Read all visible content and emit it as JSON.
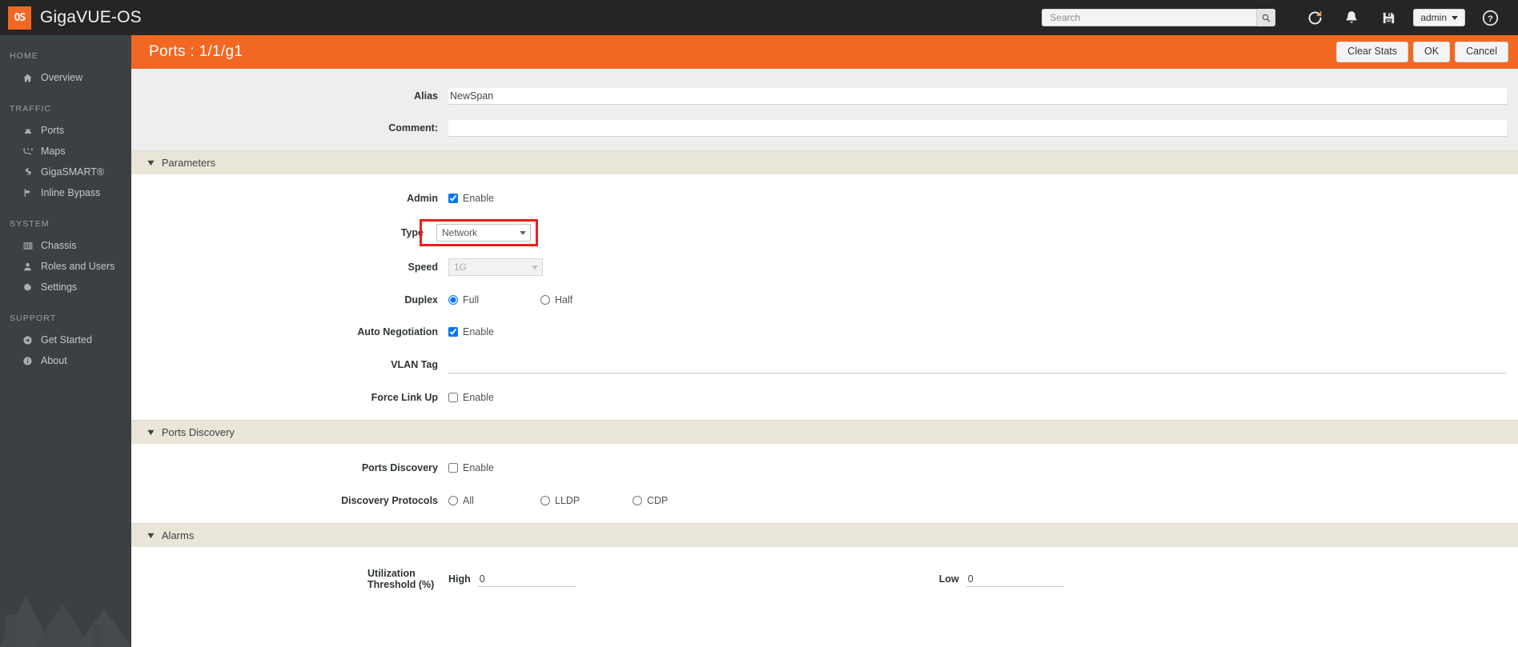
{
  "topbar": {
    "brand": "GigaVUE-OS",
    "logo_text": "OS",
    "search": {
      "placeholder": "Search",
      "value": ""
    },
    "icons": {
      "search": "search-icon",
      "refresh": "refresh-icon",
      "alerts": "bell-icon",
      "save": "save-icon",
      "help": "help-icon"
    },
    "user_menu": "admin"
  },
  "sidebar": {
    "groups": [
      {
        "label": "HOME",
        "items": [
          {
            "label": "Overview",
            "icon": "home-icon"
          }
        ]
      },
      {
        "label": "TRAFFIC",
        "items": [
          {
            "label": "Ports",
            "icon": "ports-icon"
          },
          {
            "label": "Maps",
            "icon": "maps-icon"
          },
          {
            "label": "GigaSMART®",
            "icon": "gigasmart-icon"
          },
          {
            "label": "Inline Bypass",
            "icon": "inline-bypass-icon"
          }
        ]
      },
      {
        "label": "SYSTEM",
        "items": [
          {
            "label": "Chassis",
            "icon": "chassis-icon"
          },
          {
            "label": "Roles and Users",
            "icon": "user-icon"
          },
          {
            "label": "Settings",
            "icon": "gear-icon"
          }
        ]
      },
      {
        "label": "SUPPORT",
        "items": [
          {
            "label": "Get Started",
            "icon": "arrow-circle-icon"
          },
          {
            "label": "About",
            "icon": "info-icon"
          }
        ]
      }
    ]
  },
  "page": {
    "title": "Ports : 1/1/g1",
    "accent_color": "#f26722",
    "actions": {
      "clear_stats": "Clear Stats",
      "ok": "OK",
      "cancel": "Cancel"
    }
  },
  "form": {
    "alias": {
      "label": "Alias",
      "value": "NewSpan"
    },
    "comment": {
      "label": "Comment:",
      "value": ""
    },
    "parameters": {
      "title": "Parameters",
      "admin": {
        "label": "Admin",
        "option": "Enable",
        "checked": true
      },
      "type": {
        "label": "Type",
        "value": "Network",
        "highlighted": true,
        "highlight_color": "#ee1c1c"
      },
      "speed": {
        "label": "Speed",
        "value": "1G",
        "disabled": true
      },
      "duplex": {
        "label": "Duplex",
        "options": [
          "Full",
          "Half"
        ],
        "selected": "Full"
      },
      "auto_negotiation": {
        "label": "Auto Negotiation",
        "option": "Enable",
        "checked": true
      },
      "vlan_tag": {
        "label": "VLAN Tag",
        "value": ""
      },
      "force_link_up": {
        "label": "Force Link Up",
        "option": "Enable",
        "checked": false
      }
    },
    "ports_discovery": {
      "title": "Ports Discovery",
      "enable": {
        "label": "Ports Discovery",
        "option": "Enable",
        "checked": false
      },
      "protocols": {
        "label": "Discovery Protocols",
        "options": [
          "All",
          "LLDP",
          "CDP"
        ],
        "selected": ""
      }
    },
    "alarms": {
      "title": "Alarms",
      "utilization": {
        "label": "Utilization Threshold (%)",
        "high_label": "High",
        "high_value": "0",
        "low_label": "Low",
        "low_value": "0"
      }
    }
  }
}
